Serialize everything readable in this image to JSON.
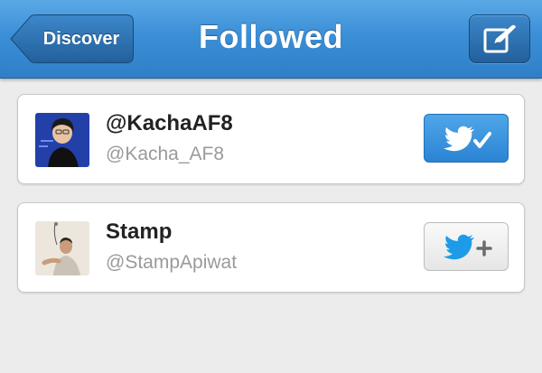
{
  "navbar": {
    "title": "Followed",
    "back_label": "Discover",
    "compose_icon": "compose-icon"
  },
  "users": [
    {
      "name": "@KachaAF8",
      "handle": "@Kacha_AF8",
      "following": true,
      "follow_icon": "twitter-bird-check-icon"
    },
    {
      "name": "Stamp",
      "handle": "@StampApiwat",
      "following": false,
      "follow_icon": "twitter-bird-plus-icon"
    }
  ],
  "colors": {
    "navbar_blue": "#3b8fd6",
    "following_button": "#2b84d4",
    "twitter_blue": "#1da1f2",
    "background": "#ececec"
  }
}
